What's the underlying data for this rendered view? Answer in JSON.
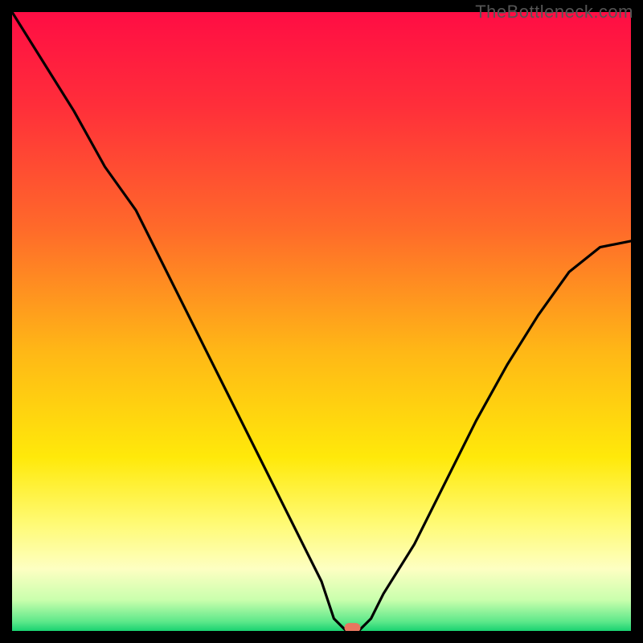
{
  "watermark": "TheBottleneck.com",
  "chart_data": {
    "type": "line",
    "title": "",
    "xlabel": "",
    "ylabel": "",
    "xlim": [
      0,
      100
    ],
    "ylim": [
      0,
      100
    ],
    "x": [
      0,
      5,
      10,
      15,
      20,
      25,
      30,
      35,
      40,
      45,
      50,
      52,
      54,
      56,
      58,
      60,
      65,
      70,
      75,
      80,
      85,
      90,
      95,
      100
    ],
    "values": [
      100,
      92,
      84,
      75,
      68,
      58,
      48,
      38,
      28,
      18,
      8,
      2,
      0,
      0,
      2,
      6,
      14,
      24,
      34,
      43,
      51,
      58,
      62,
      63
    ],
    "marker": {
      "x": 55,
      "y": 0.5
    },
    "gradient_stops": [
      {
        "offset": 0,
        "color": "#ff0d44"
      },
      {
        "offset": 15,
        "color": "#ff2e3a"
      },
      {
        "offset": 35,
        "color": "#ff6a2a"
      },
      {
        "offset": 55,
        "color": "#ffb816"
      },
      {
        "offset": 72,
        "color": "#ffe90a"
      },
      {
        "offset": 83,
        "color": "#fffb78"
      },
      {
        "offset": 90,
        "color": "#fdffc2"
      },
      {
        "offset": 95,
        "color": "#c9ffad"
      },
      {
        "offset": 98.5,
        "color": "#5de88a"
      },
      {
        "offset": 100,
        "color": "#19d271"
      }
    ]
  }
}
